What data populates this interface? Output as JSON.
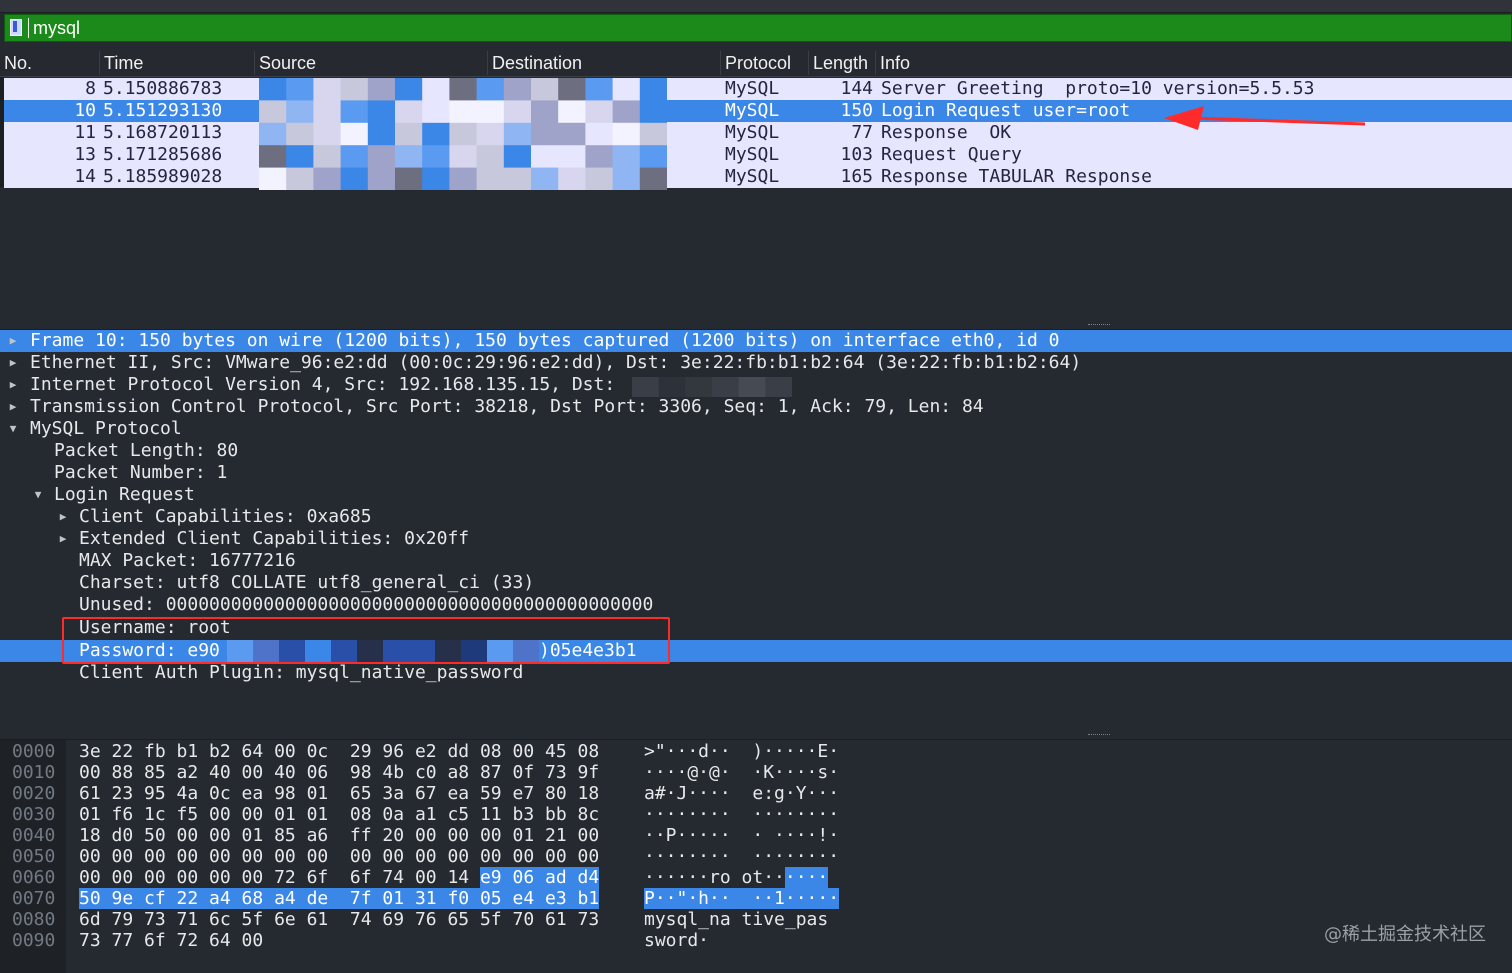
{
  "filter": {
    "value": "mysql",
    "icon": "bookmark-icon"
  },
  "packet_list": {
    "columns": [
      "No.",
      "Time",
      "Source",
      "Destination",
      "Protocol",
      "Length",
      "Info"
    ],
    "rows": [
      {
        "no": "8",
        "time": "5.150886783",
        "protocol": "MySQL",
        "length": "144",
        "info": "Server Greeting  proto=10 version=5.5.53",
        "selected": false
      },
      {
        "no": "10",
        "time": "5.151293130",
        "protocol": "MySQL",
        "length": "150",
        "info": "Login Request user=root",
        "selected": true
      },
      {
        "no": "11",
        "time": "5.168720113",
        "protocol": "MySQL",
        "length": "77",
        "info": "Response  OK",
        "selected": false
      },
      {
        "no": "13",
        "time": "5.171285686",
        "protocol": "MySQL",
        "length": "103",
        "info": "Request Query",
        "selected": false
      },
      {
        "no": "14",
        "time": "5.185989028",
        "protocol": "MySQL",
        "length": "165",
        "info": "Response TABULAR Response",
        "selected": false
      }
    ]
  },
  "details": {
    "frame": "Frame 10: 150 bytes on wire (1200 bits), 150 bytes captured (1200 bits) on interface eth0, id 0",
    "ethernet": "Ethernet II, Src: VMware_96:e2:dd (00:0c:29:96:e2:dd), Dst: 3e:22:fb:b1:b2:64 (3e:22:fb:b1:b2:64)",
    "ip": "Internet Protocol Version 4, Src: 192.168.135.15, Dst:",
    "tcp": "Transmission Control Protocol, Src Port: 38218, Dst Port: 3306, Seq: 1, Ack: 79, Len: 84",
    "mysql": "MySQL Protocol",
    "packet_length": "Packet Length: 80",
    "packet_number": "Packet Number: 1",
    "login_request": "Login Request",
    "client_caps": "Client Capabilities: 0xa685",
    "ext_client_caps": "Extended Client Capabilities: 0x20ff",
    "max_packet": "MAX Packet: 16777216",
    "charset": "Charset: utf8 COLLATE utf8_general_ci (33)",
    "unused": "Unused: 000000000000000000000000000000000000000000000",
    "username": "Username: root",
    "password_prefix": "Password: e90",
    "password_suffix": ")05e4e3b1",
    "auth_plugin": "Client Auth Plugin: mysql_native_password"
  },
  "bytes": {
    "rows": [
      {
        "offset": "0000",
        "hex": "3e 22 fb b1 b2 64 00 0c  29 96 e2 dd 08 00 45 08",
        "ascii": ">\"···d··  )·····E·"
      },
      {
        "offset": "0010",
        "hex": "00 88 85 a2 40 00 40 06  98 4b c0 a8 87 0f 73 9f",
        "ascii": "····@·@·  ·K····s·"
      },
      {
        "offset": "0020",
        "hex": "61 23 95 4a 0c ea 98 01  65 3a 67 ea 59 e7 80 18",
        "ascii": "a#·J····  e:g·Y···"
      },
      {
        "offset": "0030",
        "hex": "01 f6 1c f5 00 00 01 01  08 0a a1 c5 11 b3 bb 8c",
        "ascii": "········  ········"
      },
      {
        "offset": "0040",
        "hex": "18 d0 50 00 00 01 85 a6  ff 20 00 00 00 01 21 00",
        "ascii": "··P·····  · ····!·"
      },
      {
        "offset": "0050",
        "hex": "00 00 00 00 00 00 00 00  00 00 00 00 00 00 00 00",
        "ascii": "········  ········"
      },
      {
        "offset": "0060",
        "hex": "00 00 00 00 00 00 72 6f  6f 74 00 14 ",
        "hex_hl": "e9 06 ad d4",
        "ascii": "······ro ot··",
        "ascii_hl": "····"
      },
      {
        "offset": "0070",
        "hex": "",
        "hex_hl": "50 9e cf 22 a4 68 a4 de  7f 01 31 f0 05 e4 e3 b1",
        "ascii": "",
        "ascii_hl": "P··\"·h··  ··1·····"
      },
      {
        "offset": "0080",
        "hex": "6d 79 73 71 6c 5f 6e 61  74 69 76 65 5f 70 61 73",
        "ascii": "mysql_na tive_pas"
      },
      {
        "offset": "0090",
        "hex": "73 77 6f 72 64 00",
        "ascii": "sword·"
      }
    ]
  },
  "watermark": "@稀土掘金技术社区",
  "colors": {
    "filter_bg": "#1b8a1b",
    "selection": "#3b87e8",
    "row_bg": "#e7e6ff",
    "annotation_red": "#ff2a2a"
  }
}
